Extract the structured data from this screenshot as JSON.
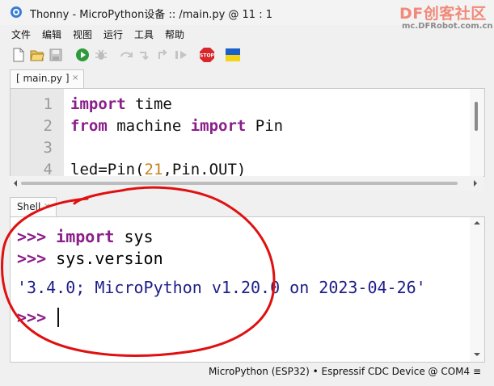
{
  "window": {
    "title": "Thonny  -  MicroPython设备 :: /main.py  @  11 : 1"
  },
  "watermark": {
    "logo": "DF创客社区",
    "url": "mc.DFRobot.com.cn"
  },
  "menu": [
    "文件",
    "编辑",
    "视图",
    "运行",
    "工具",
    "帮助"
  ],
  "toolbar": {
    "icons": [
      "new-file-icon",
      "open-file-icon",
      "save-icon",
      "run-icon",
      "debug-icon",
      "step-over-icon",
      "step-into-icon",
      "step-out-icon",
      "resume-icon",
      "stop-icon",
      "flag-icon"
    ],
    "stop_label": "STOP"
  },
  "editor": {
    "tab_label": "[ main.py ]",
    "tab_close": "×",
    "line_numbers": [
      "1",
      "2",
      "3",
      "4"
    ],
    "lines": {
      "l1_kw": "import",
      "l1_rest": " time",
      "l2_kw1": "from",
      "l2_mid": " machine ",
      "l2_kw2": "import",
      "l2_rest": " Pin",
      "l4_a": "led=Pin(",
      "l4_num": "21",
      "l4_b": ",Pin.OUT)"
    }
  },
  "shell": {
    "tab_label": "Shell",
    "tab_close": "×",
    "prompt": ">>>",
    "line1_kw": "import",
    "line1_rest": " sys",
    "line2": " sys.version",
    "output": "'3.4.0; MicroPython v1.20.0 on 2023-04-26'"
  },
  "status": {
    "text": "MicroPython (ESP32)  •  Espressif CDC Device @ COM4  ≡"
  },
  "colors": {
    "keyword": "#8a1f8a",
    "number": "#c3831d",
    "output": "#1d1d8a",
    "annotation": "#e01010"
  }
}
